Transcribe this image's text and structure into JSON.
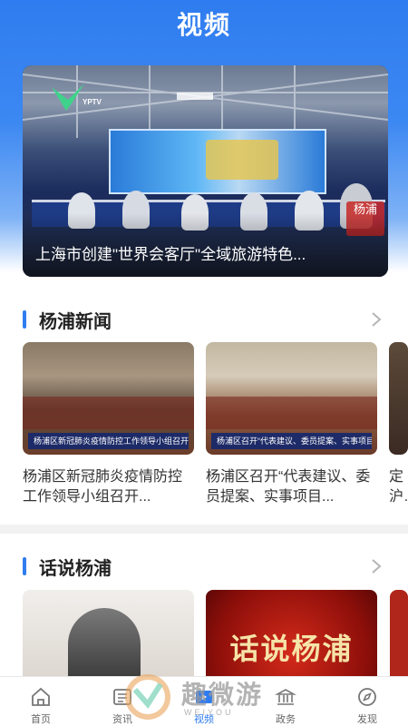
{
  "header": {
    "title": "视频"
  },
  "hero": {
    "caption": "上海市创建\"世界会客厅\"全域旅游特色...",
    "badge": "YPTV",
    "corner_badge": "杨浦"
  },
  "sections": {
    "yangpu_news": {
      "title": "杨浦新闻",
      "more_icon": "chevron-right-icon"
    },
    "talk_yangpu": {
      "title": "话说杨浦",
      "more_icon": "chevron-right-icon"
    }
  },
  "news": [
    {
      "title": "杨浦区新冠肺炎疫情防控工作领导小组召开...",
      "thumb_caption": "杨浦区新冠肺炎疫情防控工作领导小组召开例会"
    },
    {
      "title": "杨浦区召开“代表建议、委员提案、实事项目...",
      "thumb_caption": "杨浦区召开“代表建议、委员提案、实事项目”推进工作推进会"
    },
    {
      "title": "定沪生刻"
    }
  ],
  "talk": [
    {
      "label": ""
    },
    {
      "calligraphy": "话说杨浦"
    },
    {
      "label": ""
    }
  ],
  "tabbar": [
    {
      "label": "首页",
      "icon": "home-icon"
    },
    {
      "label": "资讯",
      "icon": "news-icon"
    },
    {
      "label": "视频",
      "icon": "video-icon",
      "active": true
    },
    {
      "label": "政务",
      "icon": "government-icon"
    },
    {
      "label": "发现",
      "icon": "compass-icon"
    }
  ],
  "watermark": {
    "text": "趣微游",
    "sub": "WEIYOU"
  },
  "colors": {
    "primary": "#2f7cf0",
    "text": "#333333",
    "muted": "#666666"
  }
}
